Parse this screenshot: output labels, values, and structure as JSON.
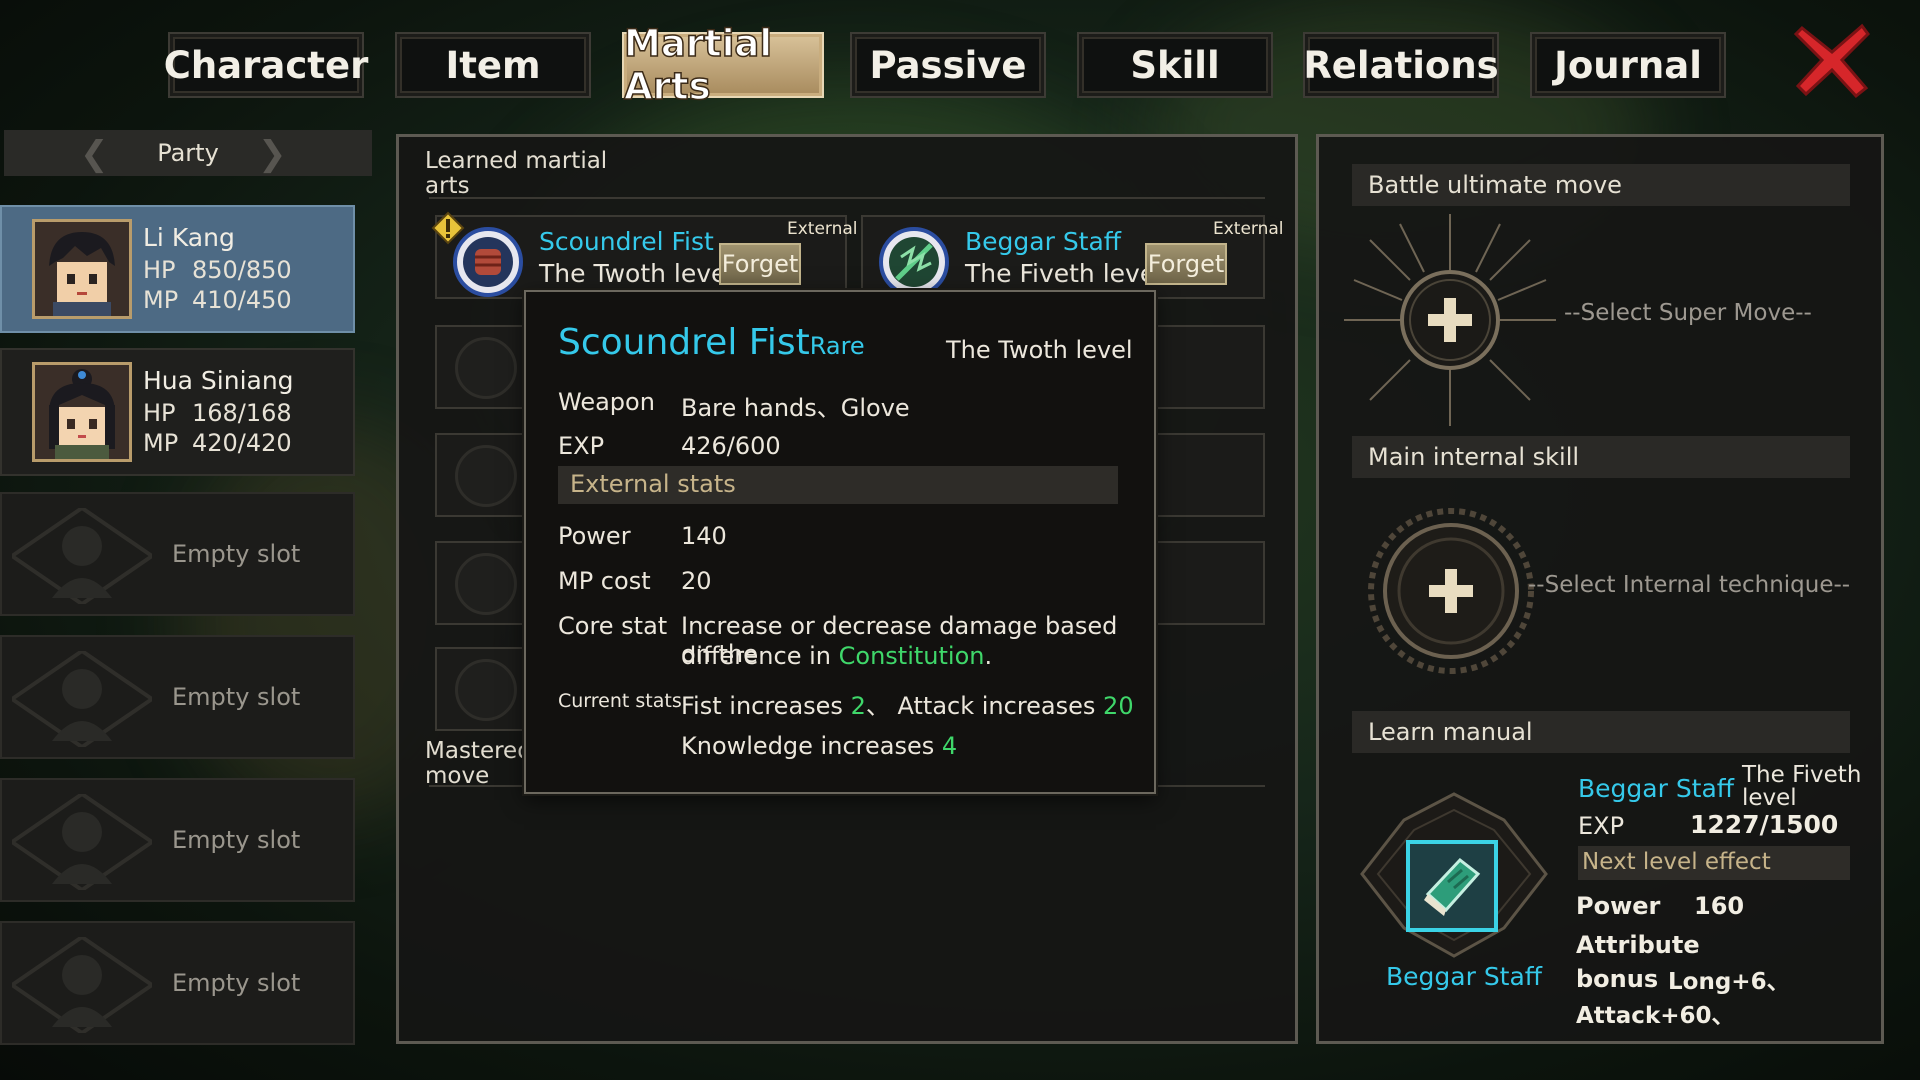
{
  "tabs": [
    {
      "label": "Character",
      "active": false
    },
    {
      "label": "Item",
      "active": false
    },
    {
      "label": "Martial Arts",
      "active": true
    },
    {
      "label": "Passive",
      "active": false
    },
    {
      "label": "Skill",
      "active": false
    },
    {
      "label": "Relations",
      "active": false
    },
    {
      "label": "Journal",
      "active": false
    }
  ],
  "close_icon": "close-x-icon",
  "party": {
    "header": "Party",
    "members": [
      {
        "name": "Li Kang",
        "hp_label": "HP",
        "hp": "850/850",
        "mp_label": "MP",
        "mp": "410/450",
        "selected": true
      },
      {
        "name": "Hua Siniang",
        "hp_label": "HP",
        "hp": "168/168",
        "mp_label": "MP",
        "mp": "420/420",
        "selected": false
      }
    ],
    "empty_slots": [
      "Empty slot",
      "Empty slot",
      "Empty slot",
      "Empty slot"
    ]
  },
  "learned": {
    "title": "Learned martial arts",
    "arts": [
      {
        "name": "Scoundrel Fist",
        "level": "The Twoth level",
        "type": "External",
        "forget": "Forget",
        "alert": true
      },
      {
        "name": "Beggar Staff",
        "level": "The Fiveth level",
        "type": "External",
        "forget": "Forget",
        "alert": false
      }
    ],
    "mastered_label": "Mastered ultimate move"
  },
  "tooltip": {
    "name": "Scoundrel Fist",
    "rarity": "Rare",
    "level": "The Twoth level",
    "weapon_label": "Weapon",
    "weapon": "Bare hands、Glove",
    "exp_label": "EXP",
    "exp": "426/600",
    "section": "External stats",
    "power_label": "Power",
    "power": "140",
    "mpcost_label": "MP cost",
    "mpcost": "20",
    "core_label": "Core stat",
    "core_text": "Increase or decrease damage based on the",
    "core_text2": "difference in",
    "core_attr": "Constitution",
    "core_end": ".",
    "current_label": "Current stats",
    "stats_line1_a": "Fist increases",
    "stats_line1_a_val": "2",
    "stats_line1_sep": "、",
    "stats_line1_b": "Attack increases",
    "stats_line1_b_val": "20",
    "stats_line2": "Knowledge increases",
    "stats_line2_val": "4"
  },
  "right": {
    "ultimate_title": "Battle ultimate move",
    "ultimate_hint": "--Select Super Move--",
    "internal_title": "Main internal skill",
    "internal_hint": "--Select Internal technique--",
    "manual_title": "Learn manual",
    "manual": {
      "name": "Beggar Staff",
      "book_name": "Beggar Staff",
      "level_line1": "The Fiveth",
      "level_line2": "level",
      "exp_label": "EXP",
      "exp": "1227/1500",
      "next_label": "Next level effect",
      "power_label": "Power",
      "power": "160",
      "attr_label1": "Attribute",
      "attr_label2": "bonus",
      "bonus1": "Long+6、",
      "bonus2": "Attack+60、"
    }
  },
  "colors": {
    "cyan": "#35c9ea",
    "green": "#3fd76a",
    "selected": "#4d6a84",
    "close": "#d6262a"
  }
}
